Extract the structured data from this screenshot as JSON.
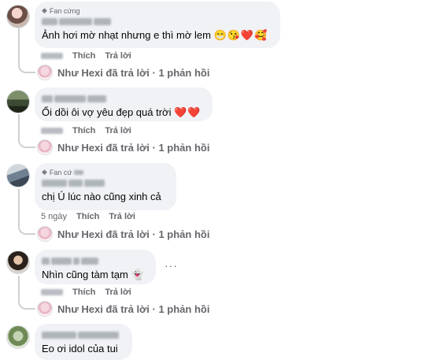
{
  "labels": {
    "like": "Thích",
    "reply": "Trả lời",
    "replies_summary": "Như Hexi đã trả lời · 1 phản hồi"
  },
  "comments": [
    {
      "badge": "Fan cứng",
      "text": "Ảnh hơi mờ nhạt nhưng e thì mờ lem",
      "emoji": "😁😘❤️🥰"
    },
    {
      "badge": "",
      "text": "Ối dồi ôi vợ yêu đẹp quá trời",
      "emoji": "❤️❤️"
    },
    {
      "badge": "Fan cứ",
      "text": "chị Ú lúc nào cũng xinh cả",
      "time": "5 ngày"
    },
    {
      "badge": "",
      "text": "Nhìn cũng tàm tạm",
      "emoji": "👻"
    },
    {
      "badge": "",
      "text": "Eo ơi idol của tui"
    }
  ],
  "more_label": "···",
  "icons": {
    "badge": "gem-icon",
    "more": "more-options-icon"
  }
}
